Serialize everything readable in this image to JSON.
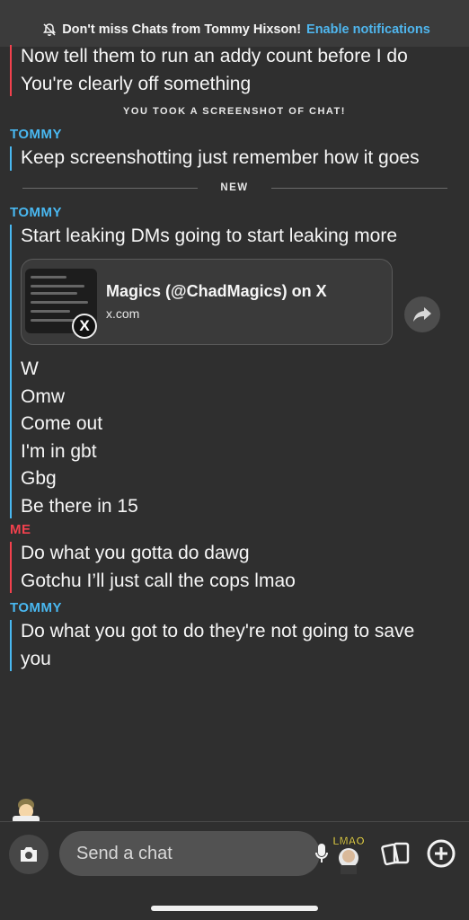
{
  "notification": {
    "text": "Don't miss Chats from Tommy Hixson!",
    "action": "Enable notifications"
  },
  "chat": {
    "groups": [
      {
        "sender": "",
        "lines": [
          "Now tell them to run an addy count before I do",
          "You're clearly off something"
        ]
      },
      {
        "note": "YOU TOOK A SCREENSHOT OF CHAT!"
      },
      {
        "sender": "TOMMY",
        "lines": [
          "Keep screenshotting just remember how it goes"
        ]
      },
      {
        "divider": "NEW"
      },
      {
        "sender": "TOMMY",
        "lines": [
          "Start leaking DMs going to start leaking more"
        ],
        "link_card": {
          "title": "Magics (@ChadMagics) on X",
          "domain": "x.com"
        },
        "lines_after": [
          "W",
          "Omw",
          "Come out",
          "I'm in gbt",
          "Gbg",
          "Be there in 15"
        ]
      },
      {
        "sender": "ME",
        "lines": [
          "Do what you gotta do dawg",
          "Gotchu I’ll just call the cops lmao"
        ]
      },
      {
        "sender": "TOMMY",
        "lines": [
          "Do what you got to do they're not going to save",
          "you"
        ]
      }
    ]
  },
  "input": {
    "placeholder": "Send a chat"
  },
  "sticker_text": "LMAO",
  "colors": {
    "tommy": "#49b8f1",
    "me": "#f2414d",
    "link": "#4fb6ee",
    "background": "#2f2f2f"
  },
  "icons": [
    "bell-off-icon",
    "x-logo-icon",
    "share-arrow-icon",
    "camera-icon",
    "microphone-icon",
    "cards-icon",
    "plus-circle-icon"
  ]
}
